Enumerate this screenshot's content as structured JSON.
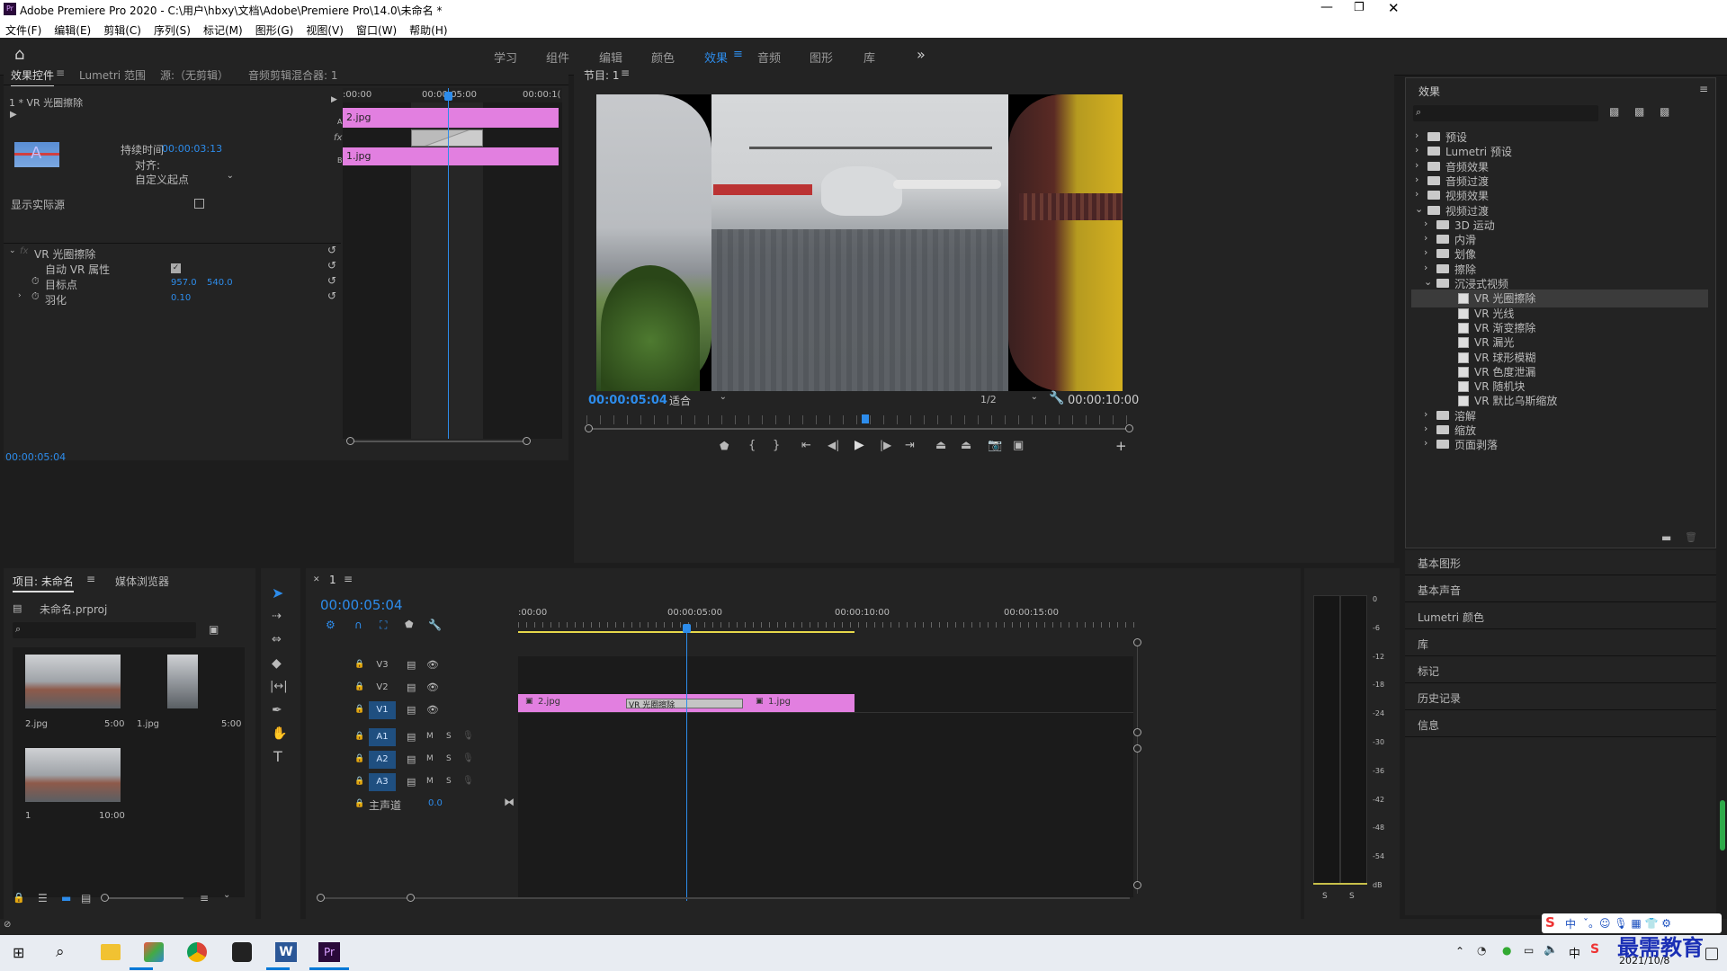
{
  "window": {
    "title": "Adobe Premiere Pro 2020 - C:\\用户\\hbxy\\文档\\Adobe\\Premiere Pro\\14.0\\未命名 *",
    "controls": [
      "minimize",
      "restore",
      "close"
    ]
  },
  "menu": [
    "文件(F)",
    "编辑(E)",
    "剪辑(C)",
    "序列(S)",
    "标记(M)",
    "图形(G)",
    "视图(V)",
    "窗口(W)",
    "帮助(H)"
  ],
  "workspaces": [
    "学习",
    "组件",
    "编辑",
    "颜色",
    "效果",
    "音频",
    "图形",
    "库"
  ],
  "workspace_active": "效果",
  "effect_controls": {
    "tabs": [
      "效果控件",
      "Lumetri 范围",
      "源:（无剪辑）",
      "音频剪辑混合器: 1"
    ],
    "clip_label": "1 * VR 光圈擦除",
    "duration_label": "持续时间",
    "duration_value": "00:00:03:13",
    "align_label": "对齐:",
    "align_value": "自定义起点",
    "show_source_label": "显示实际源",
    "section_title": "VR 光圈擦除",
    "props": [
      {
        "label": "自动 VR 属性",
        "value": ""
      },
      {
        "label": "目标点",
        "v1": "957.0",
        "v2": "540.0"
      },
      {
        "label": "羽化",
        "v1": "0.10",
        "v2": ""
      }
    ],
    "ruler": [
      ":00:00",
      "00:00:05:00",
      "00:00:1("
    ],
    "clip_a": "2.jpg",
    "clip_b": "1.jpg",
    "lane_a": "A",
    "lane_b": "B",
    "timecode": "00:00:05:04"
  },
  "program": {
    "tab": "节目: 1",
    "timecode": "00:00:05:04",
    "fit": "适合",
    "resolution": "1/2",
    "duration": "00:00:10:00"
  },
  "effects": {
    "title": "效果",
    "tree": [
      {
        "label": "预设",
        "depth": 0,
        "type": "bin"
      },
      {
        "label": "Lumetri 预设",
        "depth": 0,
        "type": "bin"
      },
      {
        "label": "音频效果",
        "depth": 0,
        "type": "folder"
      },
      {
        "label": "音频过渡",
        "depth": 0,
        "type": "folder"
      },
      {
        "label": "视频效果",
        "depth": 0,
        "type": "folder"
      },
      {
        "label": "视频过渡",
        "depth": 0,
        "type": "folder",
        "open": true
      },
      {
        "label": "3D 运动",
        "depth": 1,
        "type": "folder"
      },
      {
        "label": "内滑",
        "depth": 1,
        "type": "folder"
      },
      {
        "label": "划像",
        "depth": 1,
        "type": "folder"
      },
      {
        "label": "擦除",
        "depth": 1,
        "type": "folder"
      },
      {
        "label": "沉浸式视频",
        "depth": 1,
        "type": "folder",
        "open": true
      },
      {
        "label": "VR 光圈擦除",
        "depth": 2,
        "type": "fx",
        "selected": true
      },
      {
        "label": "VR 光线",
        "depth": 2,
        "type": "fx"
      },
      {
        "label": "VR 渐变擦除",
        "depth": 2,
        "type": "fx"
      },
      {
        "label": "VR 漏光",
        "depth": 2,
        "type": "fx"
      },
      {
        "label": "VR 球形模糊",
        "depth": 2,
        "type": "fx"
      },
      {
        "label": "VR 色度泄漏",
        "depth": 2,
        "type": "fx"
      },
      {
        "label": "VR 随机块",
        "depth": 2,
        "type": "fx"
      },
      {
        "label": "VR 默比乌斯缩放",
        "depth": 2,
        "type": "fx"
      },
      {
        "label": "溶解",
        "depth": 1,
        "type": "folder"
      },
      {
        "label": "缩放",
        "depth": 1,
        "type": "folder"
      },
      {
        "label": "页面剥落",
        "depth": 1,
        "type": "folder"
      }
    ],
    "side_panels": [
      "基本图形",
      "基本声音",
      "Lumetri 颜色",
      "库",
      "标记",
      "历史记录",
      "信息"
    ]
  },
  "project": {
    "tabs": [
      "项目: 未命名",
      "媒体浏览器"
    ],
    "file": "未命名.prproj",
    "items": [
      {
        "name": "2.jpg",
        "duration": "5:00"
      },
      {
        "name": "1.jpg",
        "duration": "5:00"
      },
      {
        "name": "1",
        "duration": "10:00"
      }
    ]
  },
  "timeline": {
    "tab": "1",
    "timecode": "00:00:05:04",
    "ruler": [
      ":00:00",
      "00:00:05:00",
      "00:00:10:00",
      "00:00:15:00"
    ],
    "video_tracks": [
      "V3",
      "V2",
      "V1"
    ],
    "audio_tracks": [
      "A1",
      "A2",
      "A3"
    ],
    "master_label": "主声道",
    "master_value": "0.0",
    "clip1": "2.jpg",
    "transition": "VR 光圈擦除",
    "clip2": "1.jpg",
    "meter_scale": [
      "0",
      "-6",
      "-12",
      "-18",
      "-24",
      "-30",
      "-36",
      "-42",
      "-48",
      "-54",
      "dB"
    ],
    "meter_solo": [
      "S",
      "S"
    ]
  },
  "taskbar": {
    "date": "2021/10/8",
    "ime": "中",
    "watermark": "最需教育"
  },
  "colors": {
    "accent": "#2d8ceb",
    "clip_pink": "#e27fe0",
    "panel_bg": "#232323",
    "dark_bg": "#1d1d1d"
  }
}
